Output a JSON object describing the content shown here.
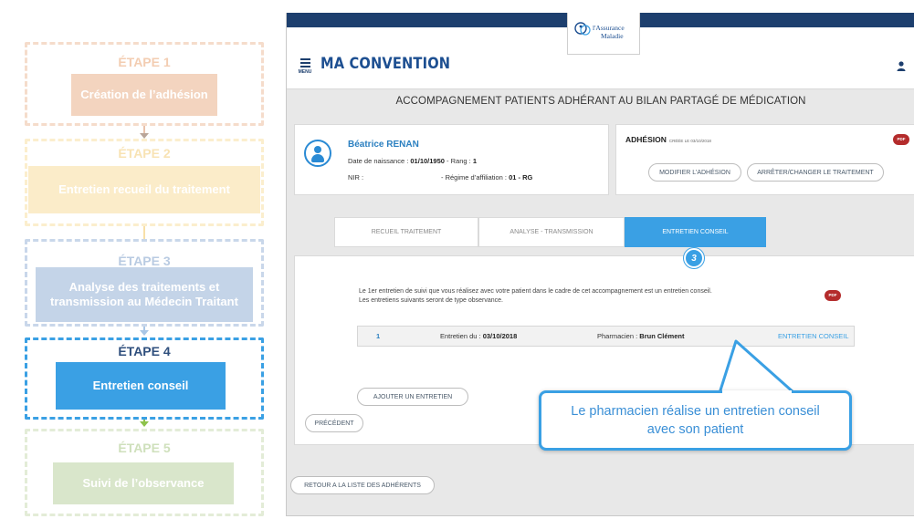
{
  "steps": [
    {
      "title": "ÉTAPE 1",
      "label": "Création de l’adhésion"
    },
    {
      "title": "ÉTAPE 2",
      "label": "Entretien recueil du traitement"
    },
    {
      "title": "ÉTAPE 3",
      "label": "Analyse des traitements et transmission au Médecin Traitant"
    },
    {
      "title": "ÉTAPE 4",
      "label": "Entretien conseil"
    },
    {
      "title": "ÉTAPE 5",
      "label": "Suivi de l’observance"
    }
  ],
  "colors": {
    "step1": "#f3d4bf",
    "step2": "#fbecc9",
    "step3": "#c4d4e8",
    "step4": "#3aa0e4",
    "step5": "#d9e6cb",
    "primary": "#3aa0e4",
    "navy": "#1d3f6e"
  },
  "logo": {
    "line1": "l'Assurance",
    "line2": "Maladie",
    "icon": "assurance-maladie-logo-icon"
  },
  "header": {
    "menu_label": "MENU",
    "title": "MA CONVENTION",
    "user_icon": "user-icon"
  },
  "page": {
    "heading": "ACCOMPAGNEMENT PATIENTS ADHÉRANT AU BILAN PARTAGÉ DE MÉDICATION"
  },
  "patient": {
    "name": "Béatrice RENAN",
    "dob_label": "Date de naissance :",
    "dob": "01/10/1950",
    "rang_label": "- Rang :",
    "rang": "1",
    "nir_label": "NIR :",
    "regime_label": "- Régime d’affiliation :",
    "regime": "01 - RG"
  },
  "adhesion": {
    "title": "ADHÉSION",
    "created": "CRÉÉE LE 03/10/2018",
    "pdf_label": "PDF",
    "modify_button": "MODIFIER L’ADHÉSION",
    "stop_button": "ARRÊTER/CHANGER LE TRAITEMENT"
  },
  "tabs": [
    {
      "label": "RECUEIL TRAITEMENT",
      "active": false
    },
    {
      "label": "ANALYSE - TRANSMISSION",
      "active": false
    },
    {
      "label": "ENTRETIEN CONSEIL",
      "active": true
    }
  ],
  "step_badge": "3",
  "content": {
    "info_line1": "Le 1er entretien de suivi que vous réalisez avec votre patient dans le cadre de cet accompagnement est un entretien conseil.",
    "info_line2": "Les entretiens suivants seront de type observance.",
    "pdf_label": "PDF",
    "session": {
      "number": "1",
      "date_label": "Entretien du :",
      "date": "03/10/2018",
      "pharmacist_label": "Pharmacien :",
      "pharmacist": "Brun Clément",
      "type": "ENTRETIEN CONSEIL"
    },
    "add_button": "AJOUTER UN ENTRETIEN"
  },
  "nav": {
    "previous_button": "PRÉCÉDENT",
    "back_button": "RETOUR A LA LISTE DES ADHÉRENTS"
  },
  "callout": {
    "text": "Le pharmacien réalise un entretien conseil avec son patient"
  }
}
